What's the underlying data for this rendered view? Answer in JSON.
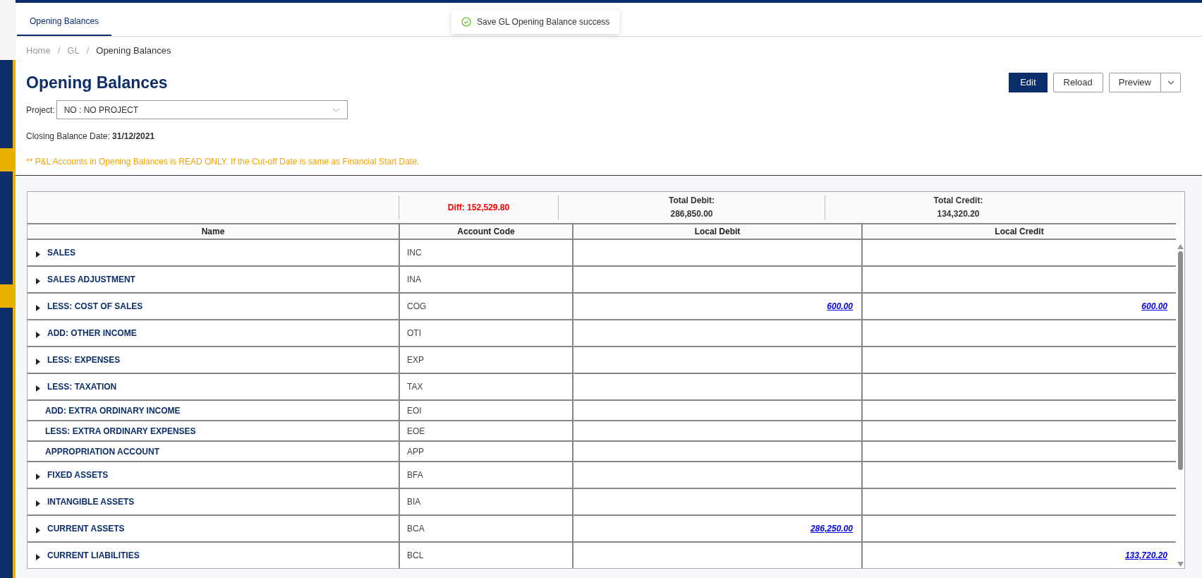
{
  "tabs": [
    {
      "label": "Opening Balances",
      "selected": true
    }
  ],
  "toast": {
    "message": "Save GL Opening Balance success"
  },
  "breadcrumb": {
    "items": [
      "Home",
      "GL",
      "Opening Balances"
    ],
    "separator": "/"
  },
  "title": "Opening Balances",
  "actions": {
    "edit": "Edit",
    "reload": "Reload",
    "preview": "Preview"
  },
  "project": {
    "label": "Project:",
    "value": "NO : NO PROJECT"
  },
  "closing_date": {
    "label": "Closing Balance Date:",
    "value": "31/12/2021"
  },
  "notice": "** P&L Accounts in Opening Balances is READ ONLY. If the Cut-off Date is same as Financial Start Date.",
  "summary": {
    "diff": "Diff: 152,529.80",
    "total_debit_label": "Total Debit:",
    "total_debit": "286,850.00",
    "total_credit_label": "Total Credit:",
    "total_credit": "134,320.20"
  },
  "table": {
    "columns": [
      "Name",
      "Account Code",
      "Local Debit",
      "Local Credit"
    ],
    "rows": [
      {
        "name": "SALES",
        "code": "INC",
        "expandable": true
      },
      {
        "name": "SALES ADJUSTMENT",
        "code": "INA",
        "expandable": true
      },
      {
        "name": "LESS: COST OF SALES",
        "code": "COG",
        "expandable": true,
        "debit": "600.00",
        "credit": "600.00"
      },
      {
        "name": "ADD: OTHER INCOME",
        "code": "OTI",
        "expandable": true
      },
      {
        "name": "LESS: EXPENSES",
        "code": "EXP",
        "expandable": true
      },
      {
        "name": "LESS: TAXATION",
        "code": "TAX",
        "expandable": true
      },
      {
        "name": "ADD: EXTRA ORDINARY INCOME",
        "code": "EOI",
        "expandable": false
      },
      {
        "name": "LESS: EXTRA ORDINARY EXPENSES",
        "code": "EOE",
        "expandable": false
      },
      {
        "name": "APPROPRIATION ACCOUNT",
        "code": "APP",
        "expandable": false
      },
      {
        "name": "FIXED ASSETS",
        "code": "BFA",
        "expandable": true
      },
      {
        "name": "INTANGIBLE ASSETS",
        "code": "BIA",
        "expandable": true
      },
      {
        "name": "CURRENT ASSETS",
        "code": "BCA",
        "expandable": true,
        "debit": "286,250.00"
      },
      {
        "name": "CURRENT LIABILITIES",
        "code": "BCL",
        "expandable": true,
        "credit": "133,720.20"
      }
    ]
  }
}
